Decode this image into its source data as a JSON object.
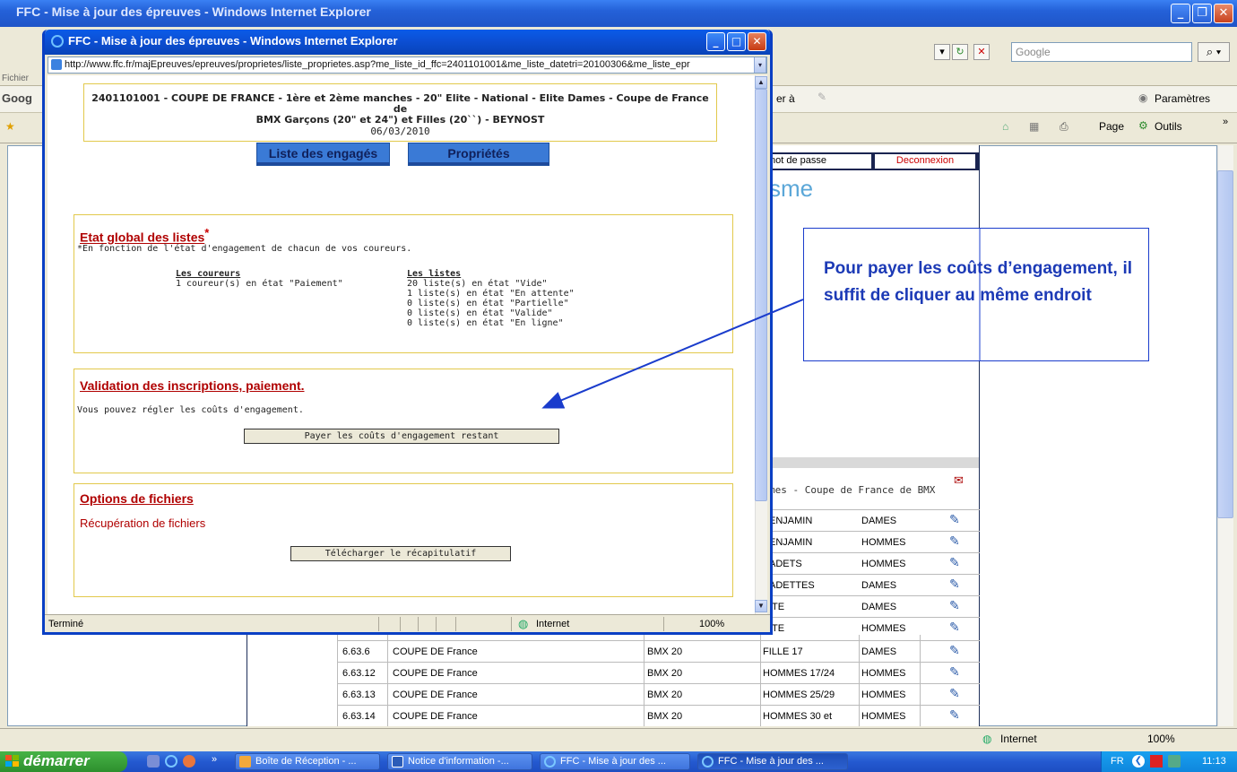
{
  "background_window": {
    "title": "FFC - Mise à jour des épreuves - Windows Internet Explorer",
    "search_placeholder": "Google",
    "menu_label": "Fichier",
    "google_label": "Goog",
    "tools_label": "er à",
    "params_label": "Paramètres",
    "page_label": "Page",
    "outils_label": "Outils"
  },
  "bg_page": {
    "nav_mot_de_passe": "not de passe",
    "nav_deconnexion": "Deconnexion",
    "brand_fragment": "sme",
    "table_caption": "mes - Coupe de France de BMX",
    "partial_rows": [
      {
        "cat": "ENJAMIN",
        "sex": "DAMES"
      },
      {
        "cat": "ENJAMIN",
        "sex": "HOMMES"
      },
      {
        "cat": "ADETS",
        "sex": "HOMMES"
      },
      {
        "cat": "ADETTES",
        "sex": "DAMES"
      },
      {
        "cat": "ITE",
        "sex": "DAMES"
      },
      {
        "cat": "ITE",
        "sex": "HOMMES"
      }
    ],
    "rows": [
      {
        "code": "6.63.6",
        "event": "COUPE DE France",
        "type": "BMX 20",
        "cat": "FILLE 17",
        "sex": "DAMES"
      },
      {
        "code": "6.63.12",
        "event": "COUPE DE France",
        "type": "BMX 20",
        "cat": "HOMMES 17/24",
        "sex": "HOMMES"
      },
      {
        "code": "6.63.13",
        "event": "COUPE DE France",
        "type": "BMX 20",
        "cat": "HOMMES 25/29",
        "sex": "HOMMES"
      },
      {
        "code": "6.63.14",
        "event": "COUPE DE France",
        "type": "BMX 20",
        "cat": "HOMMES 30 et",
        "sex": "HOMMES"
      }
    ]
  },
  "bg_status": {
    "zone": "Internet",
    "zoom": "100%"
  },
  "taskbar": {
    "start_label": "démarrer",
    "items": [
      "Boîte de Réception - ...",
      "Notice d'information -...",
      "FFC - Mise à jour des ...",
      "FFC - Mise à jour des ..."
    ],
    "lang": "FR",
    "clock": "11:13"
  },
  "popup": {
    "title": "FFC - Mise à jour des épreuves - Windows Internet Explorer",
    "address": "http://www.ffc.fr/majEpreuves/epreuves/proprietes/liste_proprietes.asp?me_liste_id_ffc=2401101001&me_liste_datetri=20100306&me_liste_epr",
    "header_line1": "2401101001 - COUPE DE FRANCE - 1ère et 2ème manches - 20\" Elite - National - Elite Dames - Coupe de France de",
    "header_line2": "BMX Garçons (20\" et 24\") et Filles (20``) - BEYNOST",
    "header_date": "06/03/2010",
    "tab_engages": "Liste des engagés",
    "tab_proprietes": "Propriétés",
    "etat": {
      "title": "Etat global des listes",
      "star": "*",
      "note": "*En fonction de l'état d'engagement de chacun de vos coureurs.",
      "coureurs_head": "Les coureurs",
      "coureurs_line": "1 coureur(s) en état \"Paiement\"",
      "listes_head": "Les listes",
      "listes_lines": [
        "20 liste(s) en état \"Vide\"",
        "1 liste(s) en état \"En attente\"",
        "0 liste(s) en état \"Partielle\"",
        "0 liste(s) en état \"Valide\"",
        "0 liste(s) en état \"En ligne\""
      ]
    },
    "validation": {
      "title": "Validation des inscriptions, paiement.",
      "text": "Vous pouvez régler les coûts d'engagement.",
      "button": "Payer les coûts d'engagement restant"
    },
    "options": {
      "title": "Options de fichiers",
      "link": "Récupération de fichiers",
      "button": "Télécharger le récapitulatif"
    },
    "status": {
      "text": "Terminé",
      "zone": "Internet",
      "zoom": "100%"
    }
  },
  "annotation": {
    "text": "Pour payer les coûts d’engagement, il suffit de cliquer au même endroit"
  },
  "colors": {
    "xp_blue": "#0c4fd4",
    "section_red": "#b00000",
    "callout_blue": "#1c3ab6",
    "section_border": "#e2c94c"
  }
}
